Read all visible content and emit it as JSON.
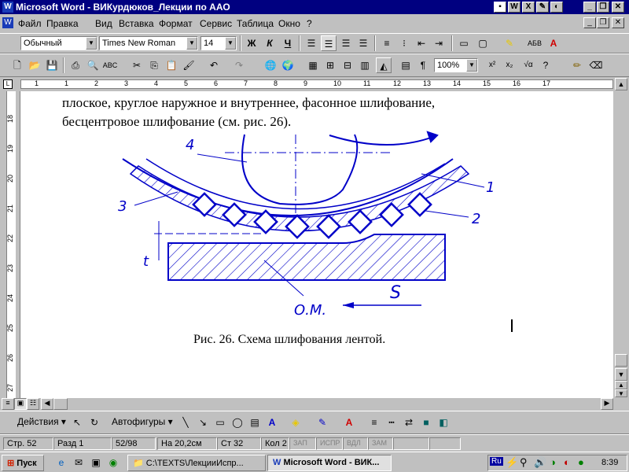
{
  "window": {
    "title": "Microsoft Word - ВИКурдюков_Лекции по ААО"
  },
  "menu": [
    "Файл",
    "Правка",
    "Вид",
    "Вставка",
    "Формат",
    "Сервис",
    "Таблица",
    "Окно",
    "?"
  ],
  "formatting": {
    "style": "Обычный",
    "font": "Times New Roman",
    "size": "14",
    "bold": "Ж",
    "italic": "К",
    "underline": "Ч"
  },
  "standard": {
    "zoom": "100%"
  },
  "ruler": {
    "h_numbers": [
      "1",
      "1",
      "2",
      "3",
      "4",
      "5",
      "6",
      "7",
      "8",
      "9",
      "10",
      "11",
      "12",
      "13",
      "14",
      "15",
      "16",
      "17"
    ],
    "v_numbers": [
      "18",
      "19",
      "20",
      "21",
      "22",
      "23",
      "24",
      "25",
      "26",
      "27"
    ]
  },
  "document": {
    "line1": "плоское, круглое наружное и внутреннее, фасонное шлифование,",
    "line2": "бесцентровое шлифование (см. рис. 26).",
    "caption": "Рис. 26. Схема  шлифования лентой.",
    "figure_labels": {
      "l1": "1",
      "l2": "2",
      "l3": "3",
      "l4": "4",
      "s": "S",
      "t": "t",
      "om": "О.М."
    }
  },
  "drawing": {
    "actions": "Действия",
    "autoshapes": "Автофигуры"
  },
  "status": {
    "page": "Стр. 52",
    "section": "Разд 1",
    "pages": "52/98",
    "at": "На 20,2см",
    "line": "Ст 32",
    "col": "Кол 2",
    "rec": "ЗАП",
    "trk": "ИСПР",
    "ext": "ВДЛ",
    "ovr": "ЗАМ"
  },
  "taskbar": {
    "start": "Пуск",
    "task1": "C:\\TEXTS\\ЛекцииИспр...",
    "task2": "Microsoft Word - ВИК...",
    "lang": "Ru",
    "clock": "8:39"
  },
  "colors": {
    "title": "#000080",
    "drawing": "#0000c8",
    "face": "#c0c0c0"
  }
}
